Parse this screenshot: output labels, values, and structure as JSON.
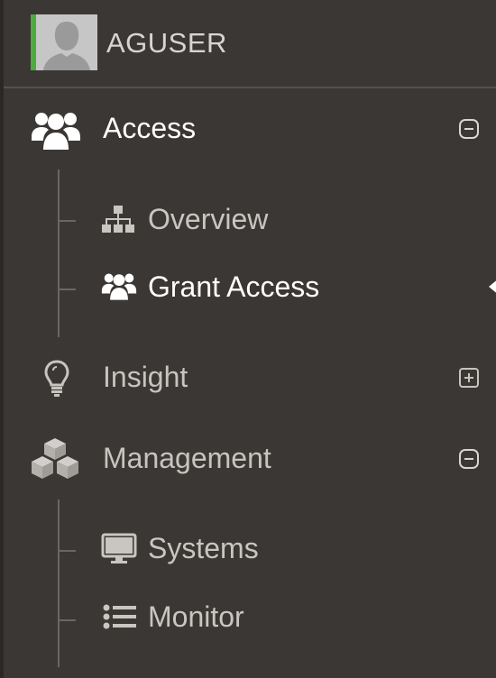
{
  "user": {
    "name": "AGUSER",
    "avatar_icon": "user-silhouette-icon",
    "status_color": "#4dab3f"
  },
  "nav": {
    "access": {
      "label": "Access",
      "icon": "users-icon",
      "toggle": "collapse-icon",
      "children": [
        {
          "label": "Overview",
          "icon": "sitemap-icon"
        },
        {
          "label": "Grant Access",
          "icon": "users-icon",
          "selected": true
        }
      ]
    },
    "insight": {
      "label": "Insight",
      "icon": "lightbulb-icon",
      "toggle": "expand-icon"
    },
    "management": {
      "label": "Management",
      "icon": "cubes-icon",
      "toggle": "collapse-icon",
      "children": [
        {
          "label": "Systems",
          "icon": "desktop-icon"
        },
        {
          "label": "Monitor",
          "icon": "list-icon"
        }
      ]
    }
  }
}
